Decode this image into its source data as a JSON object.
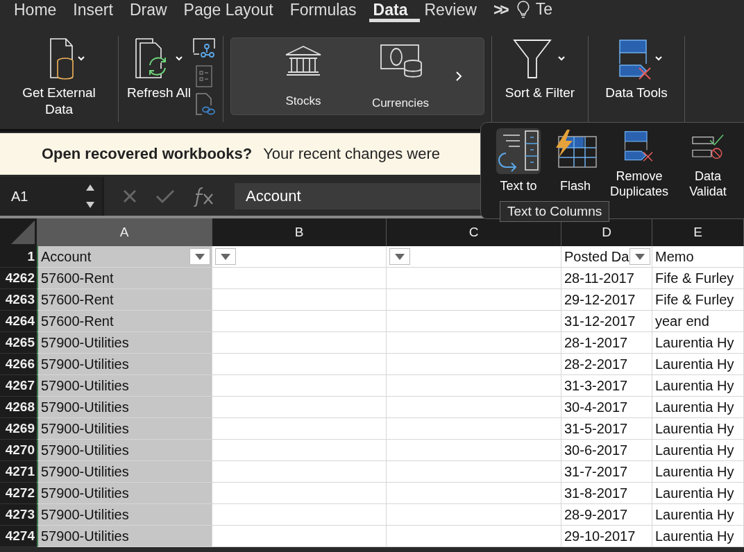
{
  "tabs": [
    {
      "label": "Home",
      "selected": false
    },
    {
      "label": "Insert",
      "selected": false
    },
    {
      "label": "Draw",
      "selected": false
    },
    {
      "label": "Page Layout",
      "selected": false
    },
    {
      "label": "Formulas",
      "selected": false
    },
    {
      "label": "Data",
      "selected": true
    },
    {
      "label": "Review",
      "selected": false
    }
  ],
  "tabs_overflow": ">>",
  "tell_me": "Te",
  "ribbon": {
    "get_external_data": "Get External Data",
    "refresh_all": "Refresh All",
    "data_types": [
      "Stocks",
      "Currencies"
    ],
    "sort_filter": "Sort & Filter",
    "data_tools": "Data Tools"
  },
  "data_tools_menu": {
    "items": [
      {
        "label": "Text to",
        "selected": true
      },
      {
        "label": "Flash",
        "selected": false
      },
      {
        "label": "Remove Duplicates",
        "selected": false
      },
      {
        "label": "Data Validat",
        "selected": false
      }
    ],
    "tooltip": "Text to Columns"
  },
  "notice": {
    "title": "Open recovered workbooks?",
    "message": "Your recent changes were"
  },
  "formula_bar": {
    "cell_ref": "A1",
    "value": "Account"
  },
  "columns": [
    {
      "label": "A",
      "selected": true
    },
    {
      "label": "B",
      "selected": false
    },
    {
      "label": "C",
      "selected": false
    },
    {
      "label": "D",
      "selected": false
    },
    {
      "label": "E",
      "selected": false
    }
  ],
  "header_row": {
    "num": "1",
    "a": "Account",
    "d": "Posted Da",
    "e": "Memo"
  },
  "rows": [
    {
      "num": "4262",
      "a": "57600-Rent",
      "d": "28-11-2017",
      "e": "Fife & Furley"
    },
    {
      "num": "4263",
      "a": "57600-Rent",
      "d": "29-12-2017",
      "e": "Fife & Furley"
    },
    {
      "num": "4264",
      "a": "57600-Rent",
      "d": "31-12-2017",
      "e": "year end"
    },
    {
      "num": "4265",
      "a": "57900-Utilities",
      "d": "28-1-2017",
      "e": "Laurentia Hy"
    },
    {
      "num": "4266",
      "a": "57900-Utilities",
      "d": "28-2-2017",
      "e": "Laurentia Hy"
    },
    {
      "num": "4267",
      "a": "57900-Utilities",
      "d": "31-3-2017",
      "e": "Laurentia Hy"
    },
    {
      "num": "4268",
      "a": "57900-Utilities",
      "d": "30-4-2017",
      "e": "Laurentia Hy"
    },
    {
      "num": "4269",
      "a": "57900-Utilities",
      "d": "31-5-2017",
      "e": "Laurentia Hy"
    },
    {
      "num": "4270",
      "a": "57900-Utilities",
      "d": "30-6-2017",
      "e": "Laurentia Hy"
    },
    {
      "num": "4271",
      "a": "57900-Utilities",
      "d": "31-7-2017",
      "e": "Laurentia Hy"
    },
    {
      "num": "4272",
      "a": "57900-Utilities",
      "d": "31-8-2017",
      "e": "Laurentia Hy"
    },
    {
      "num": "4273",
      "a": "57900-Utilities",
      "d": "28-9-2017",
      "e": "Laurentia Hy"
    },
    {
      "num": "4274",
      "a": "57900-Utilities",
      "d": "29-10-2017",
      "e": "Laurentia Hy"
    }
  ]
}
